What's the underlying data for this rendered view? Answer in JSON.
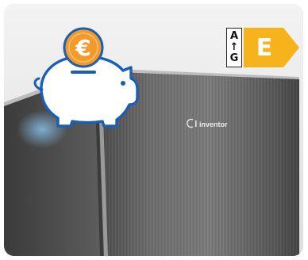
{
  "savings_badge": {
    "icon": "piggy-bank-icon",
    "coin_symbol": "€",
    "coin_color": "#f39a2b"
  },
  "product": {
    "brand_text": "inventor",
    "brand_logo": "inventor-logo-icon"
  },
  "energy_label": {
    "scale_top": "A",
    "scale_arrow": "↑",
    "scale_bottom": "G",
    "class": "E",
    "class_color": "#f6b31b"
  }
}
